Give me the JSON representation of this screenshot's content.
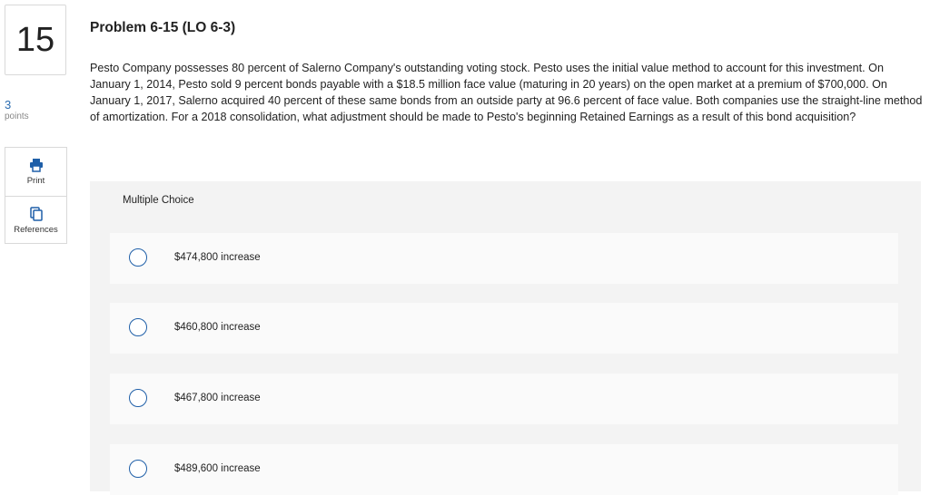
{
  "question_number": "15",
  "points": {
    "value": "3",
    "label": "points"
  },
  "tools": {
    "print_label": "Print",
    "references_label": "References"
  },
  "problem": {
    "title": "Problem 6-15 (LO 6-3)",
    "text": "Pesto Company possesses 80 percent of Salerno Company's outstanding voting stock. Pesto uses the initial value method to account for this investment. On January 1, 2014, Pesto sold 9 percent bonds payable with a $18.5 million face value (maturing in 20 years) on the open market at a premium of $700,000. On January 1, 2017, Salerno acquired 40 percent of these same bonds from an outside party at 96.6 percent of face value. Both companies use the straight-line method of amortization. For a 2018 consolidation, what adjustment should be made to Pesto's beginning Retained Earnings as a result of this bond acquisition?"
  },
  "multiple_choice": {
    "label": "Multiple Choice",
    "options": [
      {
        "label": "$474,800 increase"
      },
      {
        "label": "$460,800 increase"
      },
      {
        "label": "$467,800 increase"
      },
      {
        "label": "$489,600 increase"
      }
    ]
  },
  "colors": {
    "accent": "#1f5fa8",
    "panel": "#f3f3f3",
    "option_bg": "#fafafa"
  }
}
